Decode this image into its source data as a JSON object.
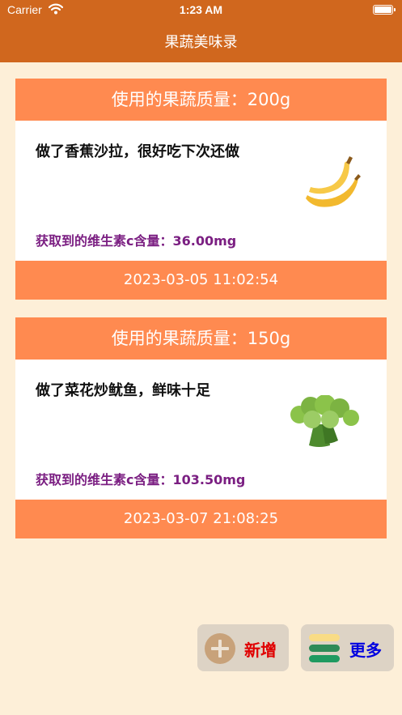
{
  "status_bar": {
    "carrier": "Carrier",
    "time": "1:23 AM"
  },
  "nav": {
    "title": "果蔬美味录"
  },
  "records": [
    {
      "mass_text": "使用的果蔬质量：200g",
      "note": "做了香蕉沙拉，很好吃下次还做",
      "vitamin_text": "获取到的维生素c含量：36.00mg",
      "timestamp": "2023-03-05 11:02:54",
      "icon": "banana-icon"
    },
    {
      "mass_text": "使用的果蔬质量：150g",
      "note": "做了菜花炒鱿鱼，鲜味十足",
      "vitamin_text": "获取到的维生素c含量：103.50mg",
      "timestamp": "2023-03-07 21:08:25",
      "icon": "broccoli-icon"
    }
  ],
  "actions": {
    "add_label": "新增",
    "more_label": "更多"
  },
  "colors": {
    "nav_bg": "#D0671E",
    "page_bg": "#FDEFD8",
    "card_accent": "#FF8A50",
    "vitamin_text": "#7B1F82",
    "add_label": "#E00000",
    "more_label": "#0000E0"
  }
}
